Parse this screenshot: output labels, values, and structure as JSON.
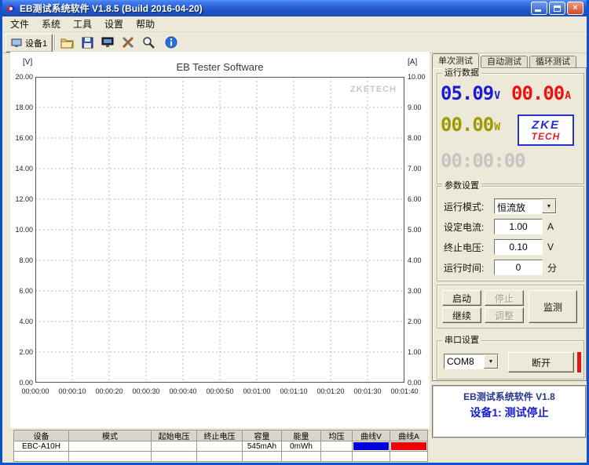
{
  "window": {
    "title": "EB测试系统软件 V1.8.5 (Build 2016-04-20)"
  },
  "menubar": {
    "items": [
      "文件",
      "系统",
      "工具",
      "设置",
      "帮助"
    ]
  },
  "toolbar": {
    "device_label": "设备1"
  },
  "chart_data": {
    "type": "line",
    "title": "EB Tester Software",
    "watermark": "ZKETECH",
    "grid": "dashed",
    "legend": "none",
    "series": [],
    "left_axis": {
      "unit": "[V]",
      "min": 0.0,
      "max": 20.0,
      "step": 2.0,
      "ticks": [
        "20.00",
        "18.00",
        "16.00",
        "14.00",
        "12.00",
        "10.00",
        "8.00",
        "6.00",
        "4.00",
        "2.00",
        "0.00"
      ]
    },
    "right_axis": {
      "unit": "[A]",
      "min": 0.0,
      "max": 10.0,
      "step": 1.0,
      "ticks": [
        "10.00",
        "9.00",
        "8.00",
        "7.00",
        "6.00",
        "5.00",
        "4.00",
        "3.00",
        "2.00",
        "1.00",
        "0.00"
      ]
    },
    "x_axis": {
      "ticks": [
        "00:00:00",
        "00:00:10",
        "00:00:20",
        "00:00:30",
        "00:00:40",
        "00:00:50",
        "00:01:00",
        "00:01:10",
        "00:01:20",
        "00:01:30",
        "00:01:40"
      ]
    }
  },
  "tabs": {
    "items": [
      {
        "label": "单次测试",
        "active": true
      },
      {
        "label": "自动测试",
        "active": false
      },
      {
        "label": "循环测试",
        "active": false
      }
    ]
  },
  "run_data": {
    "group_title": "运行数据",
    "voltage": {
      "value": "05.09",
      "unit": "V",
      "color": "#1b1bd4"
    },
    "current": {
      "value": "00.00",
      "unit": "A",
      "color": "#ee1111"
    },
    "power": {
      "value": "00.00",
      "unit": "W",
      "color": "#9b9b00"
    },
    "time": {
      "value": "00:00:00",
      "color": "#c4c4c4"
    },
    "logo": {
      "line1": "ZKE",
      "line2": "TECH"
    }
  },
  "params": {
    "group_title": "参数设置",
    "rows": [
      {
        "label": "运行模式:",
        "value": "恒流放",
        "suffix": "",
        "type": "select"
      },
      {
        "label": "设定电流:",
        "value": "1.00",
        "suffix": "A",
        "type": "input"
      },
      {
        "label": "终止电压:",
        "value": "0.10",
        "suffix": "V",
        "type": "input"
      },
      {
        "label": "运行时间:",
        "value": "0",
        "suffix": "分",
        "type": "input"
      }
    ]
  },
  "controls": {
    "start": "启动",
    "stop": "停止",
    "monitor": "监测",
    "continue": "继续",
    "adjust": "调整"
  },
  "serial": {
    "group_title": "串口设置",
    "port": "COM8",
    "disconnect": "断开"
  },
  "status": {
    "line1": "EB测试系统软件 V1.8",
    "line2": "设备1: 测试停止"
  },
  "table": {
    "headers": [
      "设备",
      "模式",
      "起始电压",
      "终止电压",
      "容量",
      "能量",
      "均压",
      "曲线V",
      "曲线A"
    ],
    "rows": [
      {
        "cells": [
          "EBC-A10H",
          "",
          "",
          "",
          "545mAh",
          "0mWh",
          ""
        ],
        "curveV": "#0000dd",
        "curveA": "#ee0000"
      },
      {
        "cells": [
          "",
          "",
          "",
          "",
          "",
          "",
          ""
        ],
        "curveV": "",
        "curveA": ""
      }
    ]
  }
}
